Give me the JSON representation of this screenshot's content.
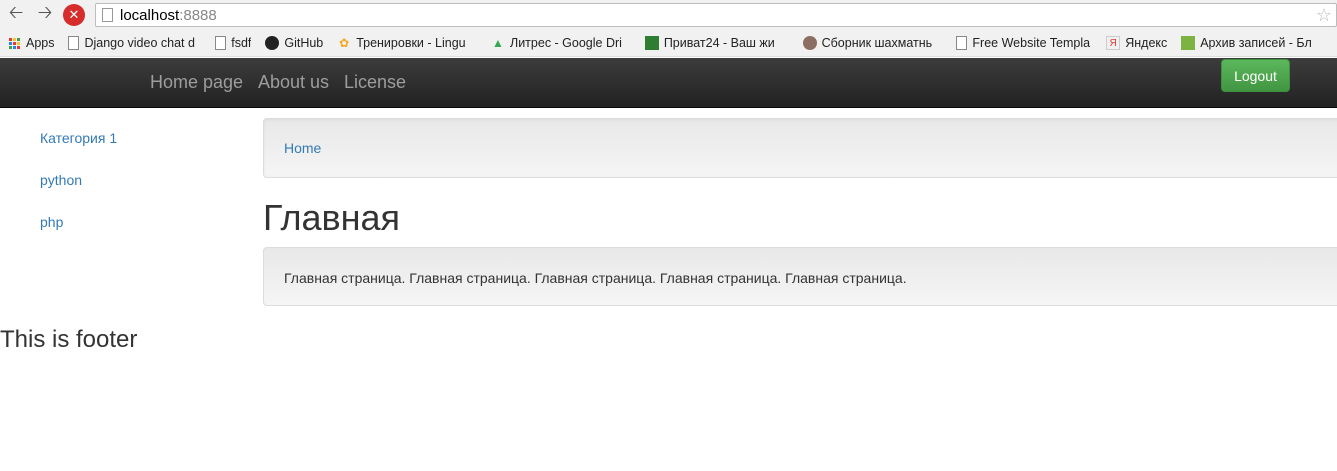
{
  "browser": {
    "url_host": "localhost",
    "url_port": ":8888",
    "bookmarks": [
      {
        "label": "Apps",
        "icon": "apps-grid-icon"
      },
      {
        "label": "Django video chat d",
        "icon": "page-icon"
      },
      {
        "label": "fsdf",
        "icon": "page-icon"
      },
      {
        "label": "GitHub",
        "icon": "github-icon"
      },
      {
        "label": "Тренировки - Lingu",
        "icon": "lingualeo-icon"
      },
      {
        "label": "Литрес - Google Dri",
        "icon": "google-drive-icon"
      },
      {
        "label": "Приват24 - Ваш жи",
        "icon": "privat24-icon"
      },
      {
        "label": "Сборник шахматнь",
        "icon": "chess-icon"
      },
      {
        "label": "Free Website Templa",
        "icon": "page-icon"
      },
      {
        "label": "Яндекс",
        "icon": "yandex-icon"
      },
      {
        "label": "Архив записей - Бл",
        "icon": "archive-icon"
      }
    ]
  },
  "navbar": {
    "links": [
      "Home page",
      "About us",
      "License"
    ],
    "logout_label": "Logout"
  },
  "sidebar": {
    "items": [
      "Категория 1",
      "python",
      "php"
    ]
  },
  "main": {
    "breadcrumb": "Home",
    "title": "Главная",
    "content": "Главная страница. Главная страница. Главная страница. Главная страница. Главная страница."
  },
  "footer": {
    "text": "This is footer"
  },
  "colors": {
    "link": "#337ab7",
    "navbar": "#222222",
    "logout": "#5cb85c"
  }
}
